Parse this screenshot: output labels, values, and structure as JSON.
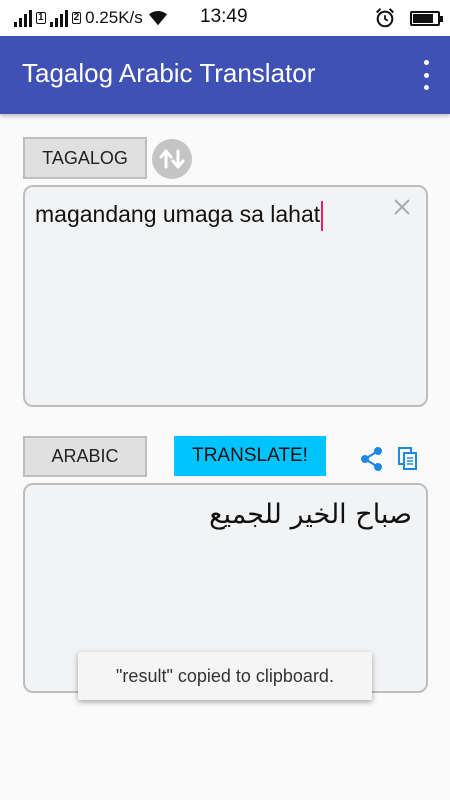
{
  "status_bar": {
    "speed": "0.25K/s",
    "time": "13:49",
    "sim1": "1",
    "sim2": "2",
    "battery_level": 0.85
  },
  "app_bar": {
    "title": "Tagalog Arabic Translator",
    "menu_icon": "more-vert-icon"
  },
  "source": {
    "language_label": "TAGALOG",
    "swap_icon": "swap-vertical-icon",
    "input_value": "magandang umaga sa lahat",
    "clear_icon": "close-icon"
  },
  "target": {
    "language_label": "ARABIC",
    "translate_label": "TRANSLATE!",
    "share_icon": "share-icon",
    "copy_icon": "copy-icon",
    "output_value": "صباح الخير للجميع"
  },
  "toast": {
    "message": "\"result\" copied to clipboard."
  },
  "colors": {
    "primary": "#3f51b5",
    "accent": "#00c4ff",
    "caret": "#e91e63",
    "icon_blue": "#1e88e5"
  }
}
